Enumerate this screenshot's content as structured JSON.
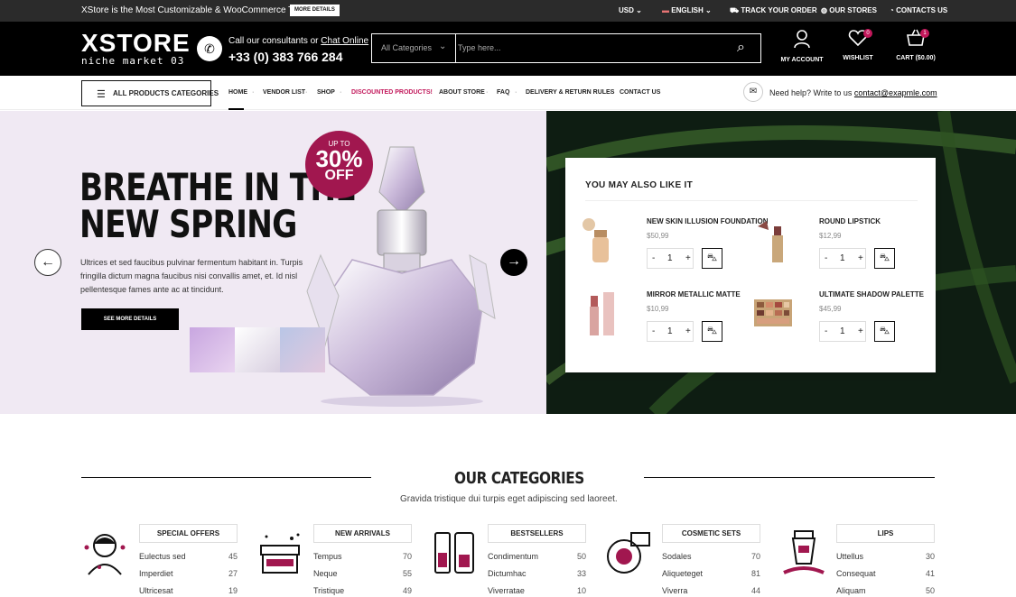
{
  "topbar": {
    "promo": "XStore is the Most Customizable & WooCommerce Theme",
    "more_details": "MORE DETAILS",
    "currency": "USD",
    "language": "ENGLISH",
    "track_order": "TRACK YOUR ORDER",
    "our_stores": "OUR STORES",
    "contacts": "CONTACTS US"
  },
  "header": {
    "logo_main": "XSTORE",
    "logo_sub": "niche market 03",
    "consult_text": "Call our consultants or",
    "consult_link": "Chat Online",
    "phone": "+33 (0) 383 766 284",
    "search": {
      "category": "All Categories",
      "placeholder": "Type here..."
    },
    "account_label": "MY ACCOUNT",
    "wishlist_label": "WISHLIST",
    "wishlist_count": "0",
    "cart_label": "CART ($0.00)",
    "cart_count": "1"
  },
  "nav": {
    "all_categories": "ALL PRODUCTS CATEGORIES",
    "items": [
      "HOME",
      "VENDOR LIST",
      "SHOP",
      "DISCOUNTED PRODUCTS!",
      "ABOUT STORE",
      "FAQ",
      "DELIVERY & RETURN RULES",
      "CONTACT US"
    ],
    "help_text": "Need help? Write to us",
    "help_email": "contact@exapmle.com"
  },
  "hero": {
    "headline1": "BREATHE IN THE",
    "headline2": "NEW SPRING",
    "sale_top": "UP TO",
    "sale_pct": "30%",
    "sale_off": "OFF",
    "description": "Ultrices et sed faucibus pulvinar fermentum habitant in. Turpis fringilla dictum magna faucibus nisi convallis amet, et. Id nisl pellentesque fames ante ac at tincidunt.",
    "button": "SEE MORE DETAILS"
  },
  "also_like": {
    "title": "YOU MAY ALSO LIKE IT",
    "products": [
      {
        "name": "NEW SKIN ILLUSION FOUNDATION",
        "price": "$50,99",
        "qty": "1"
      },
      {
        "name": "ROUND LIPSTICK",
        "price": "$12,99",
        "qty": "1"
      },
      {
        "name": "MIRROR METALLIC MATTE",
        "price": "$10,99",
        "qty": "1"
      },
      {
        "name": "ULTIMATE SHADOW PALETTE",
        "price": "$45,99",
        "qty": "1"
      }
    ]
  },
  "categories": {
    "title": "OUR CATEGORIES",
    "subtitle": "Gravida tristique dui turpis eget adipiscing sed laoreet.",
    "columns": [
      {
        "name": "SPECIAL OFFERS",
        "items": [
          {
            "label": "Eulectus sed",
            "count": "45"
          },
          {
            "label": "Imperdiet",
            "count": "27"
          },
          {
            "label": "Ultricesat",
            "count": "19"
          }
        ]
      },
      {
        "name": "NEW ARRIVALS",
        "items": [
          {
            "label": "Tempus",
            "count": "70"
          },
          {
            "label": "Neque",
            "count": "55"
          },
          {
            "label": "Tristique",
            "count": "49"
          }
        ]
      },
      {
        "name": "BESTSELLERS",
        "items": [
          {
            "label": "Condimentum",
            "count": "50"
          },
          {
            "label": "Dictumhac",
            "count": "33"
          },
          {
            "label": "Viverratae",
            "count": "10"
          }
        ]
      },
      {
        "name": "COSMETIC SETS",
        "items": [
          {
            "label": "Sodales",
            "count": "70"
          },
          {
            "label": "Aliqueteget",
            "count": "81"
          },
          {
            "label": "Viverra",
            "count": "44"
          }
        ]
      },
      {
        "name": "LIPS",
        "items": [
          {
            "label": "Uttellus",
            "count": "30"
          },
          {
            "label": "Consequat",
            "count": "41"
          },
          {
            "label": "Aliquam",
            "count": "50"
          }
        ]
      }
    ]
  },
  "colors": {
    "accent": "#a1174f",
    "dark": "#000000",
    "hero_bg": "#f0e9f3"
  }
}
